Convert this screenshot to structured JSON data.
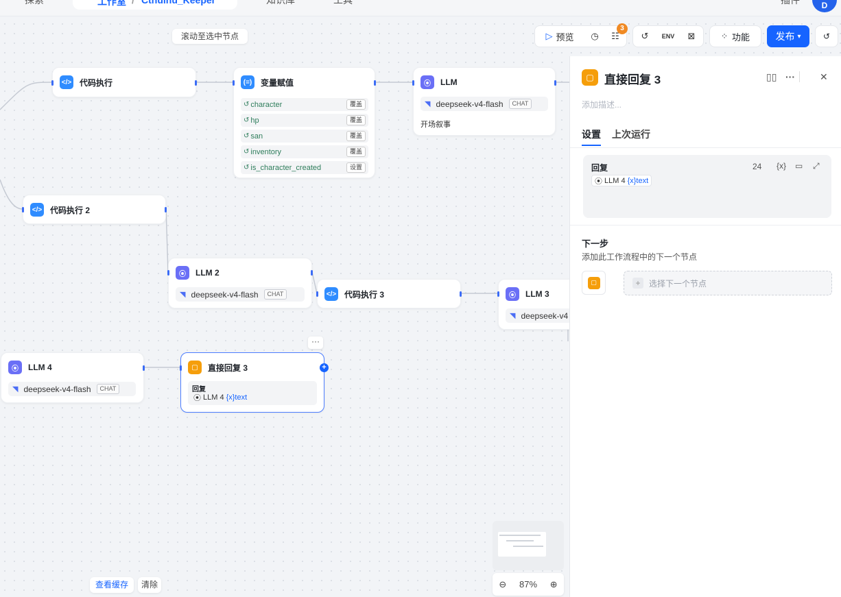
{
  "topbar": {
    "tab_explore": "探索",
    "breadcrumb_studio": "工作室",
    "breadcrumb_sep": "/",
    "breadcrumb_app": "Cthulhu_Keeper",
    "tab_knowledge": "知识库",
    "tab_tools": "工具",
    "tab_plugins": "插件",
    "avatar_letter": "D"
  },
  "canvas": {
    "scroll_to_selected": "滚动至选中节点",
    "view_cache": "查看缓存",
    "clear": "清除",
    "zoom": "87%"
  },
  "toolbar": {
    "preview": "预览",
    "issues_badge": "3",
    "features": "功能",
    "publish": "发布"
  },
  "nodes": {
    "code1": {
      "title": "代码执行"
    },
    "assign": {
      "title": "变量赋值",
      "rows": [
        {
          "name": "character",
          "op": "覆盖"
        },
        {
          "name": "hp",
          "op": "覆盖"
        },
        {
          "name": "san",
          "op": "覆盖"
        },
        {
          "name": "inventory",
          "op": "覆盖"
        },
        {
          "name": "is_character_created",
          "op": "设置"
        }
      ]
    },
    "llm1": {
      "title": "LLM",
      "model": "deepseek-v4-flash",
      "mode": "CHAT",
      "note": "开场叙事"
    },
    "code2": {
      "title": "代码执行 2"
    },
    "llm2": {
      "title": "LLM 2",
      "model": "deepseek-v4-flash",
      "mode": "CHAT"
    },
    "code3": {
      "title": "代码执行 3"
    },
    "llm3": {
      "title": "LLM 3",
      "model": "deepseek-v4"
    },
    "llm4": {
      "title": "LLM 4",
      "model": "deepseek-v4-flash",
      "mode": "CHAT"
    },
    "reply3": {
      "title": "直接回复 3",
      "field": "回复",
      "ref_node": "LLM 4",
      "ref_var": "{x}text"
    }
  },
  "panel": {
    "title": "直接回复 3",
    "desc_placeholder": "添加描述...",
    "tab_settings": "设置",
    "tab_last_run": "上次运行",
    "reply_label": "回复",
    "reply_count": "24",
    "ref_node": "LLM 4",
    "ref_var": "{x}text",
    "next_title": "下一步",
    "next_sub": "添加此工作流程中的下一个节点",
    "next_select": "选择下一个节点"
  },
  "colors": {
    "accent": "#1664ff",
    "llm_icon": "#6a6ff6",
    "code_icon": "#2f8cff",
    "reply_icon": "#f59e0b",
    "badge": "#f08a24"
  }
}
